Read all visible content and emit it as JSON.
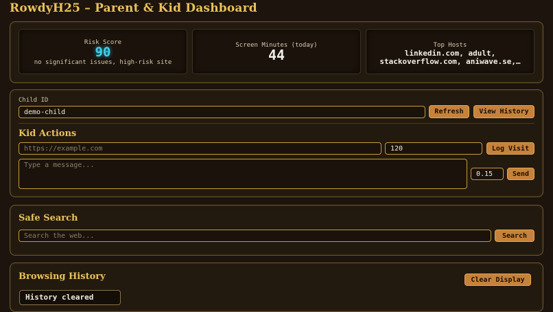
{
  "app": {
    "title": "RowdyH25 – Parent & Kid Dashboard"
  },
  "stats": {
    "risk": {
      "label": "Risk Score",
      "value": "90",
      "sub": "no significant issues, high-risk site"
    },
    "minutes": {
      "label": "Screen Minutes (today)",
      "value": "44"
    },
    "hosts": {
      "label": "Top Hosts",
      "line1": "linkedin.com, adult,",
      "line2": "stackoverflow.com, aniwave.se,…"
    }
  },
  "child": {
    "label": "Child ID",
    "value": "demo-child",
    "refresh_label": "Refresh",
    "history_label": "View History"
  },
  "kid_actions": {
    "heading": "Kid Actions",
    "url_placeholder": "https://example.com",
    "minutes_value": "120",
    "log_label": "Log Visit",
    "message_placeholder": "Type a message...",
    "score_value": "0.15",
    "send_label": "Send"
  },
  "safe_search": {
    "heading": "Safe Search",
    "placeholder": "Search the web...",
    "search_label": "Search"
  },
  "history": {
    "heading": "Browsing History",
    "clear_label": "Clear Display",
    "status": "History cleared"
  },
  "colors": {
    "accent": "#e9c15a",
    "button": "#c6823a",
    "cyan": "#3fd0e8",
    "background": "#1c140d"
  }
}
